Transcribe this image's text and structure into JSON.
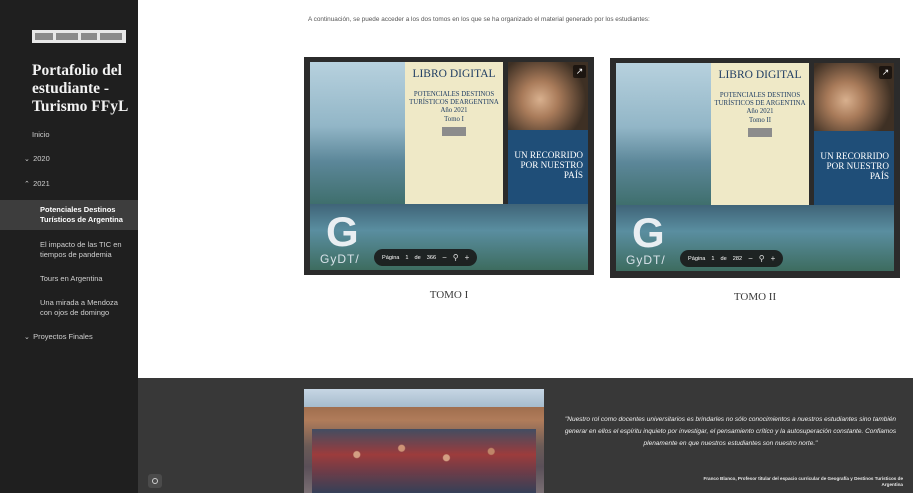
{
  "sidebar": {
    "site_title": "Portafolio del estudiante - Turismo FFyL",
    "nav": [
      {
        "label": "Inicio"
      },
      {
        "label": "2020"
      },
      {
        "label": "2021"
      },
      {
        "label": "Potenciales Destinos Turísticos de Argentina",
        "active": true
      },
      {
        "label": "El impacto de las TIC en tiempos de pandemia"
      },
      {
        "label": "Tours en Argentina"
      },
      {
        "label": "Una mirada a Mendoza con ojos de domingo"
      },
      {
        "label": "Proyectos Finales"
      }
    ]
  },
  "main": {
    "intro": "A continuación, se puede acceder a los dos tomos en los que se ha organizado el material generado por los estudiantes:",
    "tomos": [
      {
        "cover_title": "LIBRO DIGITAL",
        "cover_subtitle": "POTENCIALES DESTINOS TURÍSTICOS DEARGENTINA",
        "year": "Año 2021",
        "volume": "Tomo I",
        "blue_text": "UN RECORRIDO POR NUESTRO PAÍS",
        "logo_letter": "G",
        "logo_text": "GyDT/",
        "pager_label": "Página",
        "page": "1",
        "of": "de",
        "total": "366",
        "caption": "TOMO I"
      },
      {
        "cover_title": "LIBRO DIGITAL",
        "cover_subtitle": "POTENCIALES DESTINOS TURÍSTICOS DE ARGENTINA",
        "year": "Año 2021",
        "volume": "Tomo II",
        "blue_text": "UN RECORRIDO POR NUESTRO PAÍS",
        "logo_letter": "G",
        "logo_text": "GyDT/",
        "pager_label": "Página",
        "page": "1",
        "of": "de",
        "total": "282",
        "caption": "TOMO II"
      }
    ]
  },
  "footer": {
    "quote": "\"Nuestro rol como docentes universitarios es brindarles no sólo conocimientos a nuestros estudiantes sino también generar en ellos el espíritu inquieto por investigar, el pensamiento crítico y la autosuperación constante. Confiamos plenamente en que nuestros estudiantes son nuestro norte.\"",
    "attribution": "Franco Blanco, Profesor titular del espacio curricular de Geografía y Destinos Turísticos de Argentina"
  },
  "colors": {
    "sidebar_bg": "#1f1f1f",
    "active_item_bg": "#3d3d3d",
    "footer_bg": "#383838",
    "cover_blue": "#1f4e78",
    "cover_cream": "#efe9c7"
  }
}
